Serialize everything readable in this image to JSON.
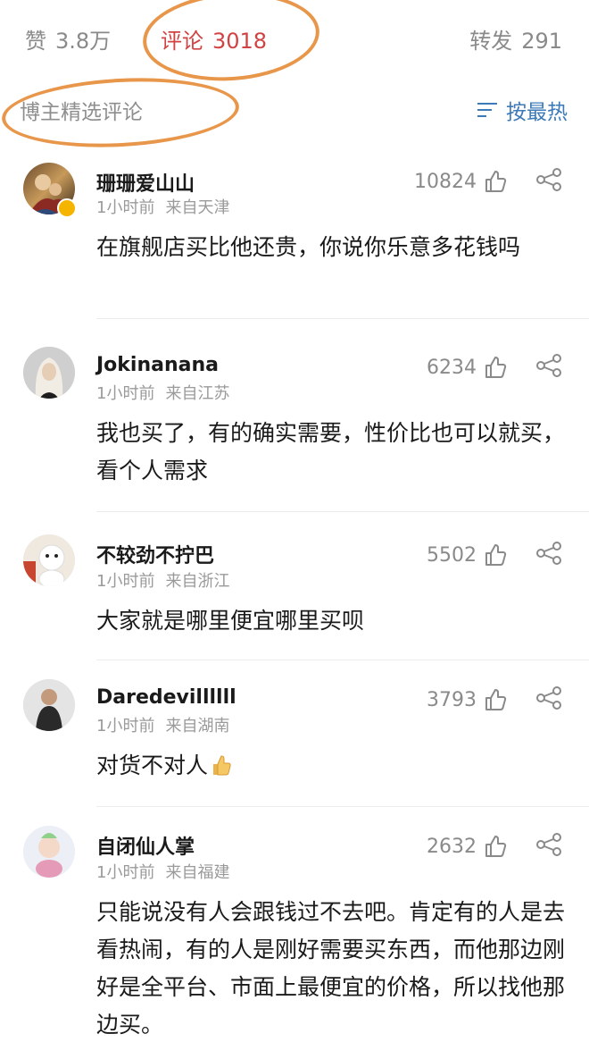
{
  "tabs": {
    "like_label": "赞",
    "like_count": "3.8万",
    "comment_label": "评论",
    "comment_count": "3018",
    "repost_label": "转发",
    "repost_count": "291"
  },
  "filter": {
    "label": "博主精选评论",
    "sort_label": "按最热"
  },
  "colors": {
    "accent": "#d14343",
    "link": "#3d7ab8",
    "annotation": "#e8964a"
  },
  "comments": [
    {
      "user": "珊珊爱山山",
      "time": "1小时前",
      "location": "来自天津",
      "likes": "10824",
      "text": "在旗舰店买比他还贵，你说你乐意多花钱吗",
      "verified": true
    },
    {
      "user": "Jokinanana",
      "time": "1小时前",
      "location": "来自江苏",
      "likes": "6234",
      "text": "我也买了，有的确实需要，性价比也可以就买，看个人需求"
    },
    {
      "user": "不较劲不拧巴",
      "time": "1小时前",
      "location": "来自浙江",
      "likes": "5502",
      "text": "大家就是哪里便宜哪里买呗"
    },
    {
      "user": "Daredevillllll",
      "time": "1小时前",
      "location": "来自湖南",
      "likes": "3793",
      "text": "对货不对人"
    },
    {
      "user": "自闭仙人掌",
      "time": "1小时前",
      "location": "来自福建",
      "likes": "2632",
      "text": "只能说没有人会跟钱过不去吧。肯定有的人是去看热闹，有的人是刚好需要买东西，而他那边刚好是全平台、市面上最便宜的价格，所以找他那边买。"
    }
  ]
}
